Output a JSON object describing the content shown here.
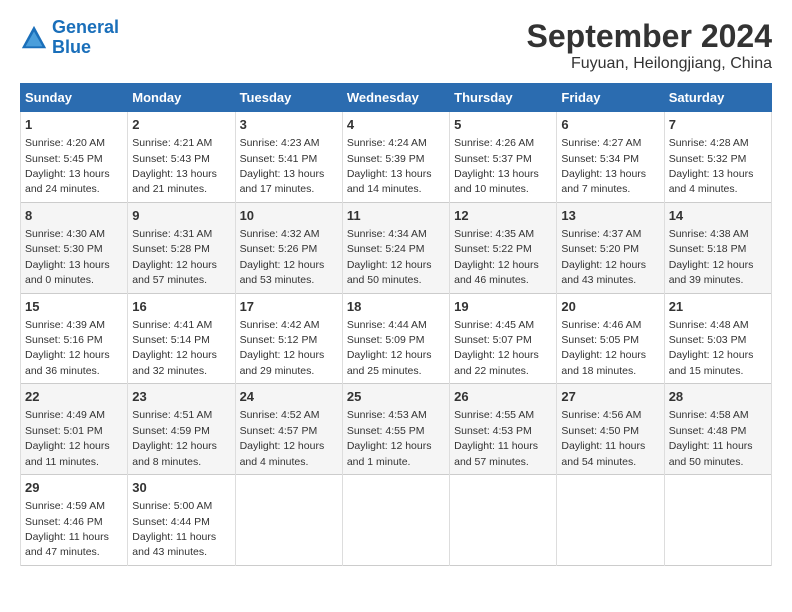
{
  "header": {
    "logo_line1": "General",
    "logo_line2": "Blue",
    "month": "September 2024",
    "location": "Fuyuan, Heilongjiang, China"
  },
  "weekdays": [
    "Sunday",
    "Monday",
    "Tuesday",
    "Wednesday",
    "Thursday",
    "Friday",
    "Saturday"
  ],
  "weeks": [
    [
      {
        "day": "1",
        "info": "Sunrise: 4:20 AM\nSunset: 5:45 PM\nDaylight: 13 hours\nand 24 minutes."
      },
      {
        "day": "2",
        "info": "Sunrise: 4:21 AM\nSunset: 5:43 PM\nDaylight: 13 hours\nand 21 minutes."
      },
      {
        "day": "3",
        "info": "Sunrise: 4:23 AM\nSunset: 5:41 PM\nDaylight: 13 hours\nand 17 minutes."
      },
      {
        "day": "4",
        "info": "Sunrise: 4:24 AM\nSunset: 5:39 PM\nDaylight: 13 hours\nand 14 minutes."
      },
      {
        "day": "5",
        "info": "Sunrise: 4:26 AM\nSunset: 5:37 PM\nDaylight: 13 hours\nand 10 minutes."
      },
      {
        "day": "6",
        "info": "Sunrise: 4:27 AM\nSunset: 5:34 PM\nDaylight: 13 hours\nand 7 minutes."
      },
      {
        "day": "7",
        "info": "Sunrise: 4:28 AM\nSunset: 5:32 PM\nDaylight: 13 hours\nand 4 minutes."
      }
    ],
    [
      {
        "day": "8",
        "info": "Sunrise: 4:30 AM\nSunset: 5:30 PM\nDaylight: 13 hours\nand 0 minutes."
      },
      {
        "day": "9",
        "info": "Sunrise: 4:31 AM\nSunset: 5:28 PM\nDaylight: 12 hours\nand 57 minutes."
      },
      {
        "day": "10",
        "info": "Sunrise: 4:32 AM\nSunset: 5:26 PM\nDaylight: 12 hours\nand 53 minutes."
      },
      {
        "day": "11",
        "info": "Sunrise: 4:34 AM\nSunset: 5:24 PM\nDaylight: 12 hours\nand 50 minutes."
      },
      {
        "day": "12",
        "info": "Sunrise: 4:35 AM\nSunset: 5:22 PM\nDaylight: 12 hours\nand 46 minutes."
      },
      {
        "day": "13",
        "info": "Sunrise: 4:37 AM\nSunset: 5:20 PM\nDaylight: 12 hours\nand 43 minutes."
      },
      {
        "day": "14",
        "info": "Sunrise: 4:38 AM\nSunset: 5:18 PM\nDaylight: 12 hours\nand 39 minutes."
      }
    ],
    [
      {
        "day": "15",
        "info": "Sunrise: 4:39 AM\nSunset: 5:16 PM\nDaylight: 12 hours\nand 36 minutes."
      },
      {
        "day": "16",
        "info": "Sunrise: 4:41 AM\nSunset: 5:14 PM\nDaylight: 12 hours\nand 32 minutes."
      },
      {
        "day": "17",
        "info": "Sunrise: 4:42 AM\nSunset: 5:12 PM\nDaylight: 12 hours\nand 29 minutes."
      },
      {
        "day": "18",
        "info": "Sunrise: 4:44 AM\nSunset: 5:09 PM\nDaylight: 12 hours\nand 25 minutes."
      },
      {
        "day": "19",
        "info": "Sunrise: 4:45 AM\nSunset: 5:07 PM\nDaylight: 12 hours\nand 22 minutes."
      },
      {
        "day": "20",
        "info": "Sunrise: 4:46 AM\nSunset: 5:05 PM\nDaylight: 12 hours\nand 18 minutes."
      },
      {
        "day": "21",
        "info": "Sunrise: 4:48 AM\nSunset: 5:03 PM\nDaylight: 12 hours\nand 15 minutes."
      }
    ],
    [
      {
        "day": "22",
        "info": "Sunrise: 4:49 AM\nSunset: 5:01 PM\nDaylight: 12 hours\nand 11 minutes."
      },
      {
        "day": "23",
        "info": "Sunrise: 4:51 AM\nSunset: 4:59 PM\nDaylight: 12 hours\nand 8 minutes."
      },
      {
        "day": "24",
        "info": "Sunrise: 4:52 AM\nSunset: 4:57 PM\nDaylight: 12 hours\nand 4 minutes."
      },
      {
        "day": "25",
        "info": "Sunrise: 4:53 AM\nSunset: 4:55 PM\nDaylight: 12 hours\nand 1 minute."
      },
      {
        "day": "26",
        "info": "Sunrise: 4:55 AM\nSunset: 4:53 PM\nDaylight: 11 hours\nand 57 minutes."
      },
      {
        "day": "27",
        "info": "Sunrise: 4:56 AM\nSunset: 4:50 PM\nDaylight: 11 hours\nand 54 minutes."
      },
      {
        "day": "28",
        "info": "Sunrise: 4:58 AM\nSunset: 4:48 PM\nDaylight: 11 hours\nand 50 minutes."
      }
    ],
    [
      {
        "day": "29",
        "info": "Sunrise: 4:59 AM\nSunset: 4:46 PM\nDaylight: 11 hours\nand 47 minutes."
      },
      {
        "day": "30",
        "info": "Sunrise: 5:00 AM\nSunset: 4:44 PM\nDaylight: 11 hours\nand 43 minutes."
      },
      {
        "day": "",
        "info": ""
      },
      {
        "day": "",
        "info": ""
      },
      {
        "day": "",
        "info": ""
      },
      {
        "day": "",
        "info": ""
      },
      {
        "day": "",
        "info": ""
      }
    ]
  ]
}
